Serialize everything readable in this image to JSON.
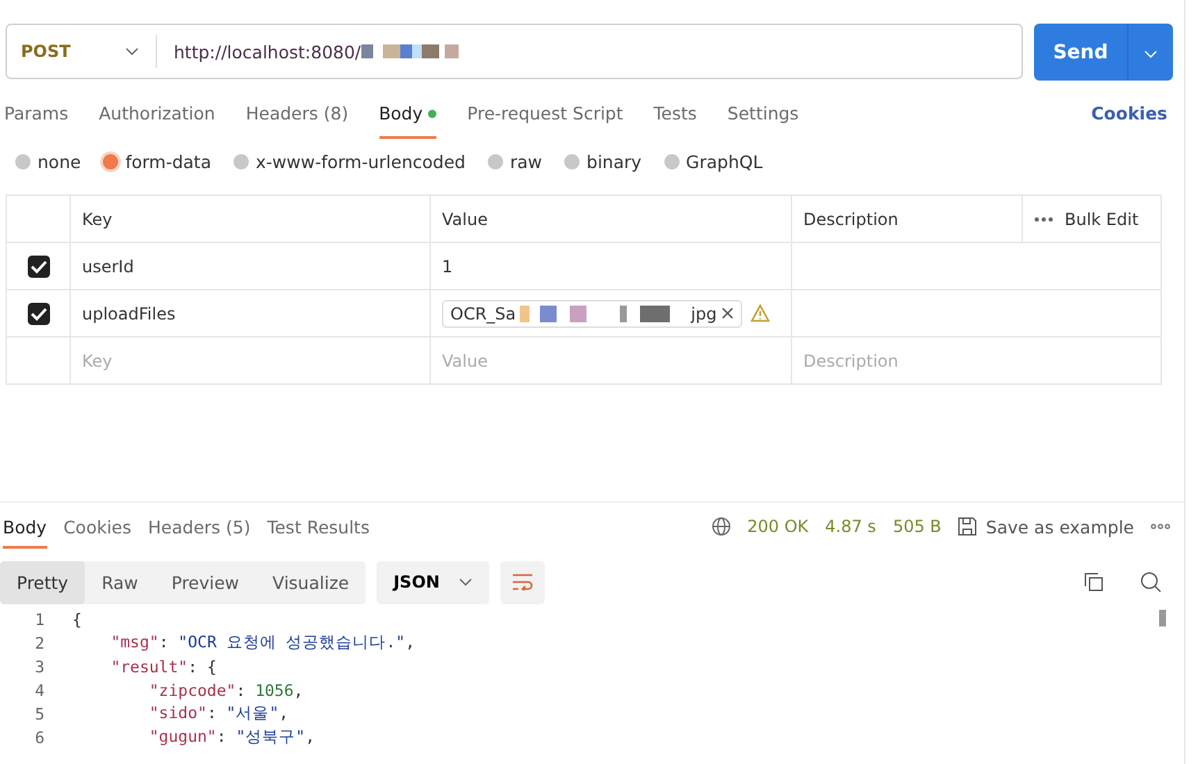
{
  "request": {
    "method": "POST",
    "url": "http://localhost:8080/",
    "send": "Send"
  },
  "request_tabs": [
    {
      "label": "Params",
      "selected": false,
      "dot": false
    },
    {
      "label": "Authorization",
      "selected": false,
      "dot": false
    },
    {
      "label": "Headers (8)",
      "selected": false,
      "dot": false
    },
    {
      "label": "Body",
      "selected": true,
      "dot": true
    },
    {
      "label": "Pre-request Script",
      "selected": false,
      "dot": false
    },
    {
      "label": "Tests",
      "selected": false,
      "dot": false
    },
    {
      "label": "Settings",
      "selected": false,
      "dot": false
    }
  ],
  "cookies_link": "Cookies",
  "body_types": [
    {
      "label": "none",
      "selected": false
    },
    {
      "label": "form-data",
      "selected": true
    },
    {
      "label": "x-www-form-urlencoded",
      "selected": false
    },
    {
      "label": "raw",
      "selected": false
    },
    {
      "label": "binary",
      "selected": false
    },
    {
      "label": "GraphQL",
      "selected": false
    }
  ],
  "table": {
    "columns": [
      "Key",
      "Value",
      "Description"
    ],
    "bulk_edit": "Bulk Edit",
    "rows": [
      {
        "checked": true,
        "key": "userId",
        "kind": "text",
        "value": "1"
      },
      {
        "checked": true,
        "key": "uploadFiles",
        "kind": "file",
        "value": "OCR_Sa",
        "value_end": "jpg"
      }
    ],
    "placeholder_row": {
      "key": "Key",
      "value": "Value",
      "description": "Description"
    }
  },
  "response_tabs": [
    {
      "label": "Body",
      "selected": true
    },
    {
      "label": "Cookies",
      "selected": false
    },
    {
      "label": "Headers (5)",
      "selected": false
    },
    {
      "label": "Test Results",
      "selected": false
    }
  ],
  "status": {
    "code": "200 OK",
    "time": "4.87 s",
    "size": "505 B",
    "save": "Save as example"
  },
  "view_modes": [
    {
      "label": "Pretty",
      "selected": true
    },
    {
      "label": "Raw",
      "selected": false
    },
    {
      "label": "Preview",
      "selected": false
    },
    {
      "label": "Visualize",
      "selected": false
    }
  ],
  "format": "JSON",
  "code": [
    {
      "number": "1",
      "tokens": [
        {
          "kind": "punct",
          "text": "{"
        }
      ]
    },
    {
      "number": "2",
      "tokens": [
        {
          "kind": "key",
          "text": "    \"msg\""
        },
        {
          "kind": "punct",
          "text": ": "
        },
        {
          "kind": "string",
          "text": "\"OCR 요청에 성공했습니다.\""
        },
        {
          "kind": "punct",
          "text": ","
        }
      ]
    },
    {
      "number": "3",
      "tokens": [
        {
          "kind": "key",
          "text": "    \"result\""
        },
        {
          "kind": "punct",
          "text": ": {"
        }
      ]
    },
    {
      "number": "4",
      "tokens": [
        {
          "kind": "key",
          "text": "        \"zipcode\""
        },
        {
          "kind": "punct",
          "text": ": "
        },
        {
          "kind": "number",
          "text": "1056"
        },
        {
          "kind": "punct",
          "text": ","
        }
      ]
    },
    {
      "number": "5",
      "tokens": [
        {
          "kind": "key",
          "text": "        \"sido\""
        },
        {
          "kind": "punct",
          "text": ": "
        },
        {
          "kind": "string",
          "text": "\"서울\""
        },
        {
          "kind": "punct",
          "text": ","
        }
      ]
    },
    {
      "number": "6",
      "tokens": [
        {
          "kind": "key",
          "text": "        \"gugun\""
        },
        {
          "kind": "punct",
          "text": ": "
        },
        {
          "kind": "string",
          "text": "\"성북구\""
        },
        {
          "kind": "punct",
          "text": ","
        }
      ]
    }
  ]
}
